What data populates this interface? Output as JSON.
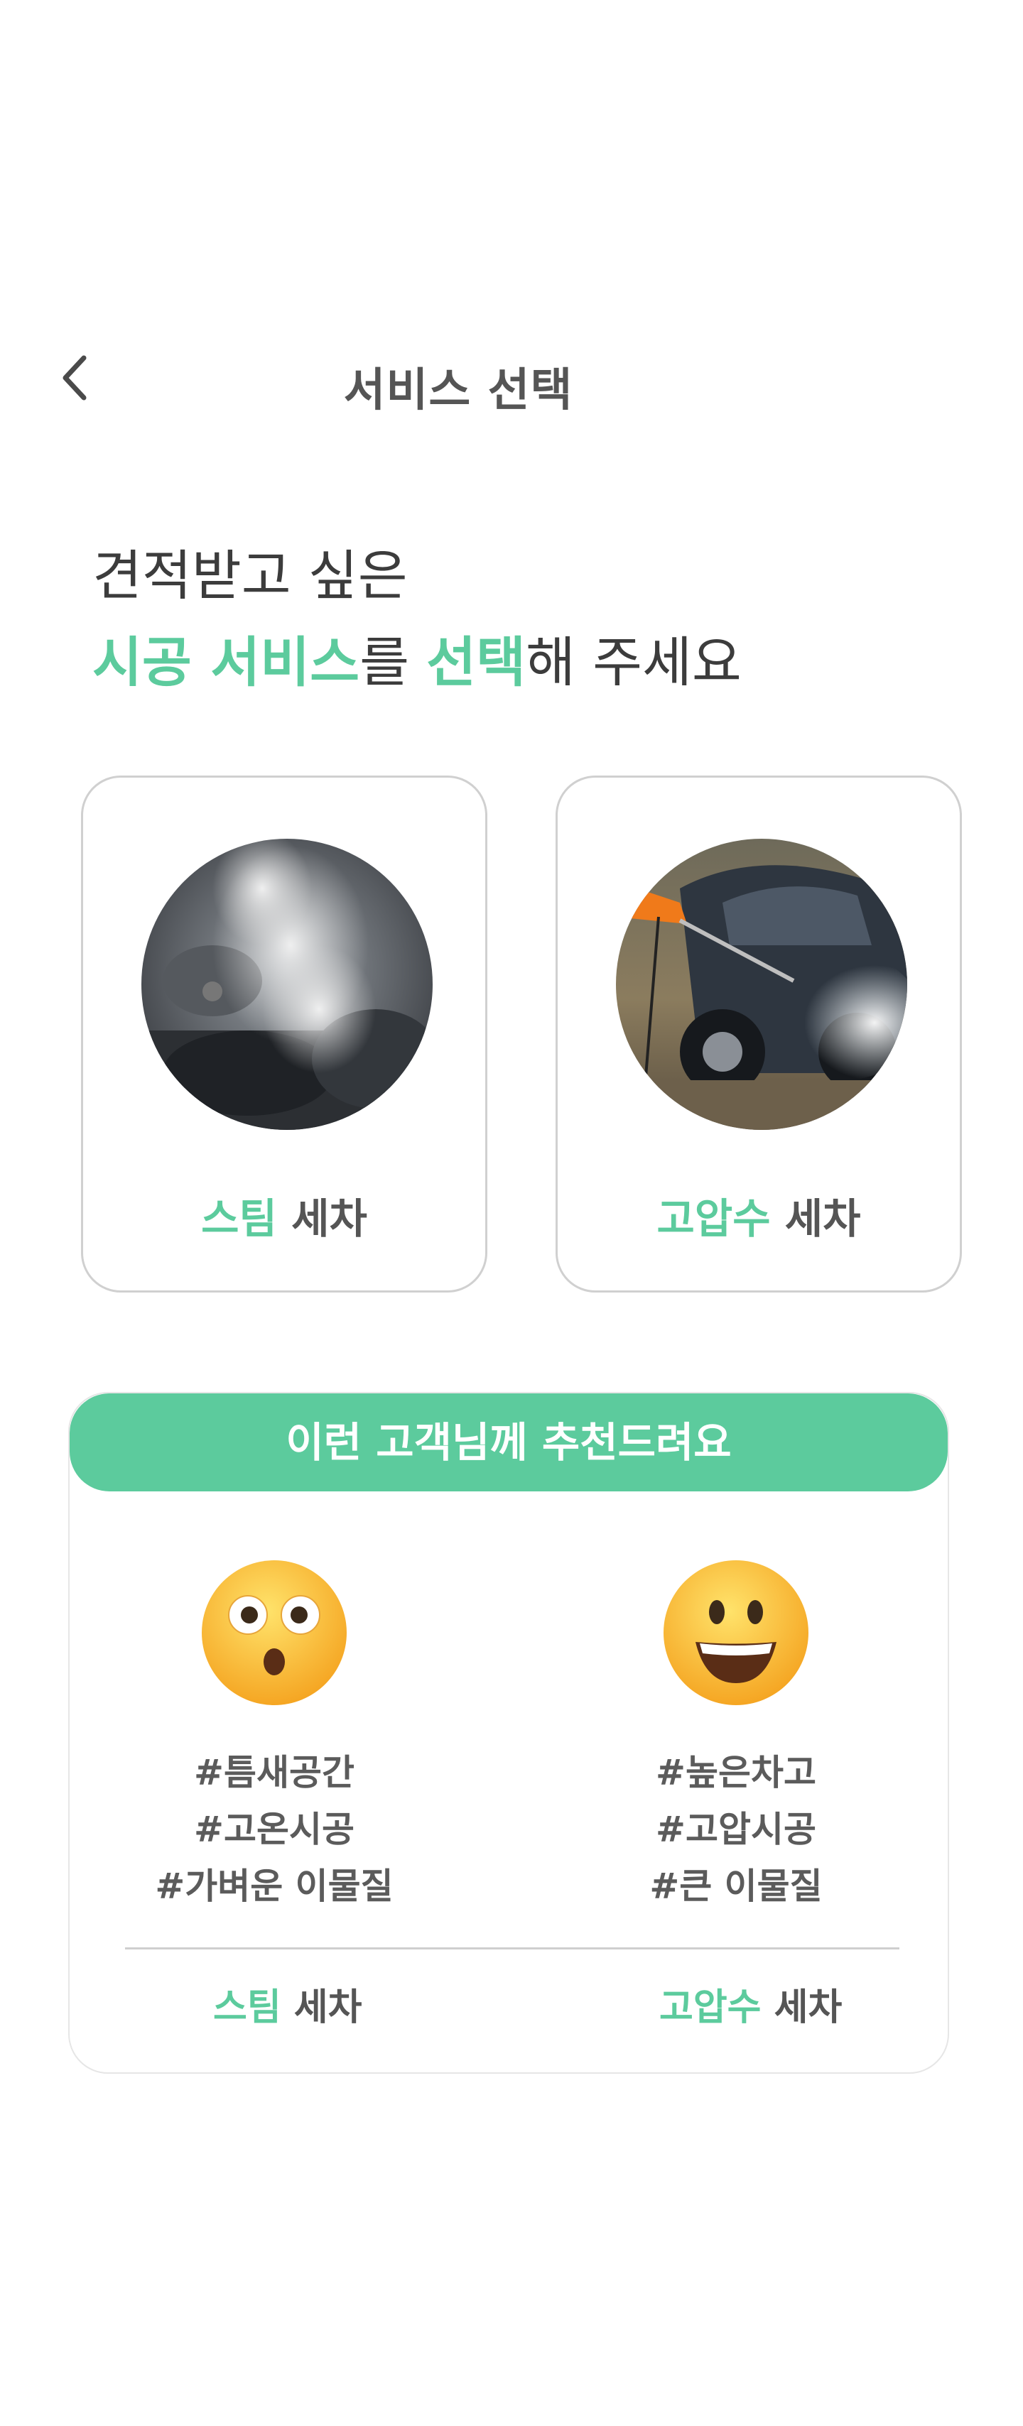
{
  "header": {
    "title": "서비스 선택",
    "back_icon": "chevron-left-icon"
  },
  "headline": {
    "line1": "견적받고 싶은",
    "line2_accent1": "시공 서비스",
    "line2_mid": "를 ",
    "line2_accent2": "선택",
    "line2_end": "해 주세요"
  },
  "services": [
    {
      "accent": "스팀",
      "rest": " 세차",
      "image": "steam-car-interior-photo"
    },
    {
      "accent": "고압수",
      "rest": " 세차",
      "image": "pressure-washing-car-photo"
    }
  ],
  "recommend": {
    "banner": "이런 고객님께 추천드려요",
    "columns": [
      {
        "emoji": "surprised-face-emoji",
        "tags": [
          "#틈새공간",
          "#고온시공",
          "#가벼운 이물질"
        ],
        "label_accent": "스팀",
        "label_rest": " 세차"
      },
      {
        "emoji": "grinning-face-emoji",
        "tags": [
          "#높은차고",
          "#고압시공",
          "#큰 이물질"
        ],
        "label_accent": "고압수",
        "label_rest": " 세차"
      }
    ]
  },
  "colors": {
    "accent": "#5ccb9d",
    "text": "#555555",
    "border": "#d0d0d0"
  }
}
